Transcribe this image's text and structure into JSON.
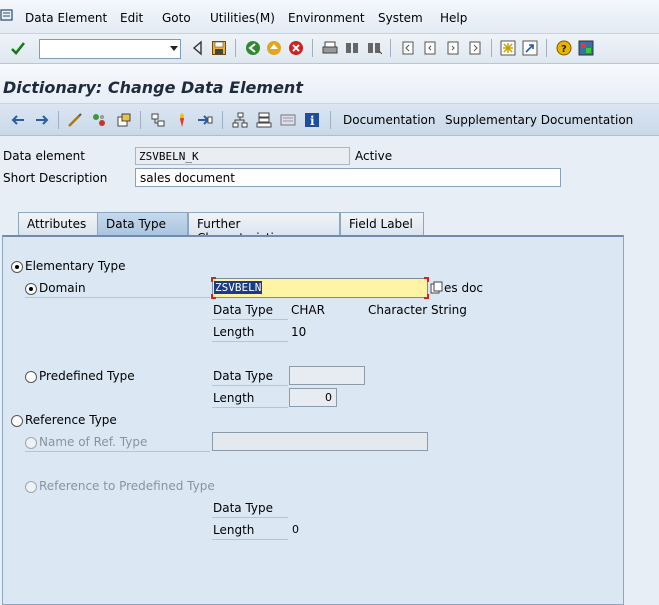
{
  "menu": {
    "items": [
      "Data Element",
      "Edit",
      "Goto",
      "Utilities(M)",
      "Environment",
      "System",
      "Help"
    ]
  },
  "toolbar": {
    "command_value": "",
    "icons": [
      "enter-icon",
      "back-icon",
      "save-icon",
      "back-green-icon",
      "exit-icon",
      "cancel-icon",
      "print-icon",
      "find-icon",
      "find-next-icon",
      "first-page-icon",
      "prev-page-icon",
      "next-page-icon",
      "last-page-icon",
      "new-session-icon",
      "shortcut-icon",
      "help-icon",
      "layout-menu-icon"
    ]
  },
  "title": "Dictionary: Change Data Element",
  "app_toolbar": {
    "documentation": "Documentation",
    "supplementary": "Supplementary Documentation"
  },
  "header": {
    "data_element_label": "Data element",
    "data_element_value": "ZSVBELN_K",
    "status": "Active",
    "short_desc_label": "Short Description",
    "short_desc_value": "sales document"
  },
  "tabs": [
    "Attributes",
    "Data Type",
    "Further Characteristics",
    "Field Label"
  ],
  "active_tab": "Data Type",
  "panel": {
    "elementary_type": "Elementary Type",
    "domain": "Domain",
    "domain_value": "ZSVBELN",
    "domain_desc_tail": "es doc",
    "data_type_label": "Data Type",
    "data_type_value": "CHAR",
    "data_type_desc": "Character String",
    "length_label": "Length",
    "length_value": "10",
    "predefined_type": "Predefined Type",
    "pre_data_type_label": "Data Type",
    "pre_length_label": "Length",
    "pre_length_value": "0",
    "reference_type": "Reference Type",
    "name_of_ref_type": "Name of Ref. Type",
    "ref_predef": "Reference to Predefined Type",
    "ref_data_type_label": "Data Type",
    "ref_length_label": "Length",
    "ref_length_value": "0"
  }
}
